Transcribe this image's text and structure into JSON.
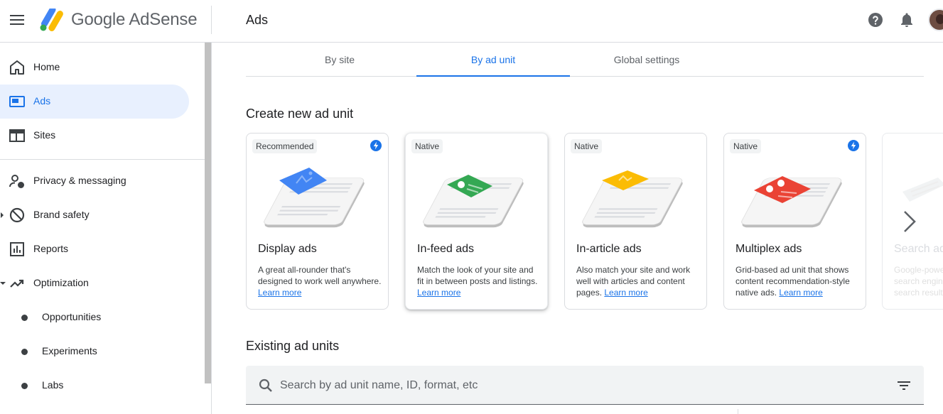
{
  "app": {
    "brand": "Google AdSense",
    "page_title": "Ads"
  },
  "sidebar": {
    "items": [
      {
        "label": "Home",
        "icon": "home-icon"
      },
      {
        "label": "Ads",
        "icon": "ads-icon",
        "active": true
      },
      {
        "label": "Sites",
        "icon": "sites-icon"
      },
      {
        "label": "Privacy & messaging",
        "icon": "privacy-icon"
      },
      {
        "label": "Brand safety",
        "icon": "block-icon"
      },
      {
        "label": "Reports",
        "icon": "reports-icon"
      },
      {
        "label": "Optimization",
        "icon": "trending-up-icon"
      },
      {
        "label": "Opportunities"
      },
      {
        "label": "Experiments"
      },
      {
        "label": "Labs"
      }
    ]
  },
  "tabs": [
    {
      "label": "By site"
    },
    {
      "label": "By ad unit",
      "active": true
    },
    {
      "label": "Global settings"
    }
  ],
  "create_section": {
    "title": "Create new ad unit",
    "cards": [
      {
        "chip": "Recommended",
        "title": "Display ads",
        "desc": "A great all-rounder that's designed to work well anywhere.",
        "link": "Learn more",
        "auto_ads": true,
        "accent": "#4285f4"
      },
      {
        "chip": "Native",
        "title": "In-feed ads",
        "desc": "Match the look of your site and fit in between posts and listings.",
        "link": "Learn more",
        "auto_ads": false,
        "accent": "#34a853"
      },
      {
        "chip": "Native",
        "title": "In-article ads",
        "desc": "Also match your site and work well with articles and content pages.",
        "link": "Learn more",
        "auto_ads": false,
        "accent": "#fbbc04"
      },
      {
        "chip": "Native",
        "title": "Multiplex ads",
        "desc": "Grid-based ad unit that shows content recommendation-style native ads.",
        "link": "Learn more",
        "auto_ads": true,
        "accent": "#ea4335"
      }
    ],
    "partial_card": {
      "title": "Search ads",
      "desc": "Google-powered search engine that search results"
    }
  },
  "existing_section": {
    "title": "Existing ad units",
    "search_placeholder": "Search by ad unit name, ID, format, etc"
  },
  "colors": {
    "accent": "#1a73e8",
    "active_nav_bg": "#e8f0fe",
    "divider": "#dadce0"
  }
}
